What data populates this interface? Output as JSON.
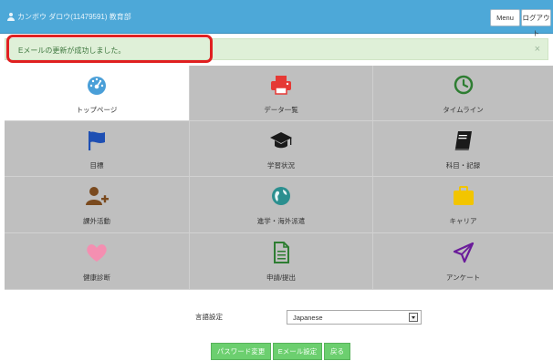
{
  "header": {
    "user_text": "カンボウ ダロウ(11479591) 教育部",
    "menu_label": "Menu",
    "logout_label": "ログアウト"
  },
  "alert": {
    "message": "Eメールの更新が成功しました。",
    "close_symbol": "×"
  },
  "tiles": [
    {
      "label": "トップページ",
      "icon": "dashboard-icon",
      "color": "#4a9fd8",
      "active": true
    },
    {
      "label": "データ一覧",
      "icon": "printer-icon",
      "color": "#e53935"
    },
    {
      "label": "タイムライン",
      "icon": "clock-icon",
      "color": "#2e7d32"
    },
    {
      "label": "目標",
      "icon": "flag-icon",
      "color": "#1e4fb3"
    },
    {
      "label": "学習状況",
      "icon": "graduation-cap-icon",
      "color": "#1a1a1a"
    },
    {
      "label": "科目・記録",
      "icon": "book-icon",
      "color": "#1a1a1a"
    },
    {
      "label": "課外活動",
      "icon": "user-plus-icon",
      "color": "#7a4a1e"
    },
    {
      "label": "進学・海外派遣",
      "icon": "globe-icon",
      "color": "#2b8f8f"
    },
    {
      "label": "キャリア",
      "icon": "briefcase-icon",
      "color": "#f2c500"
    },
    {
      "label": "健康診断",
      "icon": "heart-icon",
      "color": "#f48fb1"
    },
    {
      "label": "申請/提出",
      "icon": "document-icon",
      "color": "#2e7d32"
    },
    {
      "label": "アンケート",
      "icon": "paper-plane-icon",
      "color": "#6a1b9a"
    }
  ],
  "language": {
    "label": "言語設定",
    "selected": "Japanese"
  },
  "buttons": {
    "password": "パスワード変更",
    "email": "Eメール設定",
    "back": "戻る"
  }
}
